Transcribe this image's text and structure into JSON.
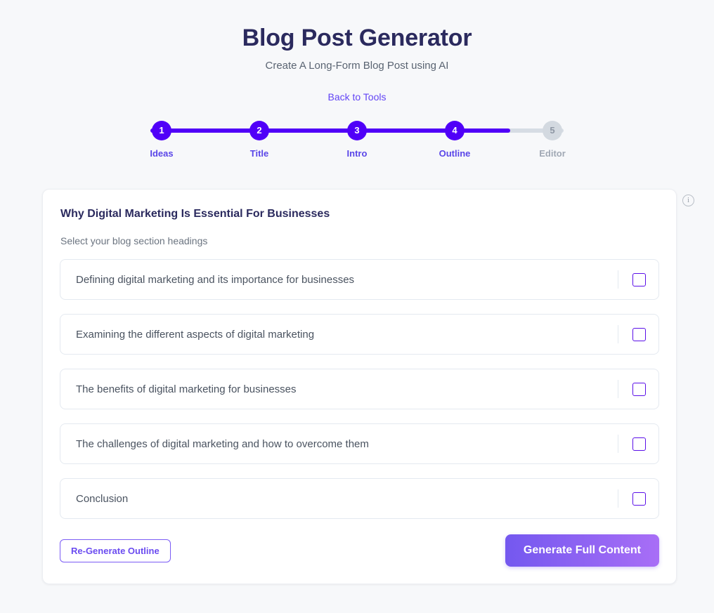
{
  "header": {
    "title": "Blog Post Generator",
    "subtitle": "Create A Long-Form Blog Post using AI"
  },
  "back_link": {
    "label": "Back to Tools"
  },
  "stepper": {
    "active_step": 4,
    "fill_percent": 87,
    "active_color": "#5000f8",
    "inactive_color": "#d3d9e0",
    "steps": [
      {
        "number": "1",
        "label": "Ideas",
        "state": "active"
      },
      {
        "number": "2",
        "label": "Title",
        "state": "active"
      },
      {
        "number": "3",
        "label": "Intro",
        "state": "active"
      },
      {
        "number": "4",
        "label": "Outline",
        "state": "active"
      },
      {
        "number": "5",
        "label": "Editor",
        "state": "inactive"
      }
    ]
  },
  "card": {
    "title": "Why Digital Marketing Is Essential For Businesses",
    "subtitle": "Select your blog section headings",
    "headings": [
      {
        "text": "Defining digital marketing and its importance for businesses",
        "checked": false
      },
      {
        "text": "Examining the different aspects of digital marketing",
        "checked": false
      },
      {
        "text": "The benefits of digital marketing for businesses",
        "checked": false
      },
      {
        "text": "The challenges of digital marketing and how to overcome them",
        "checked": false
      },
      {
        "text": "Conclusion",
        "checked": false
      }
    ],
    "footer": {
      "regenerate_label": "Re-Generate Outline",
      "generate_label": "Generate Full Content"
    }
  },
  "info_icon": {
    "glyph": "i"
  }
}
